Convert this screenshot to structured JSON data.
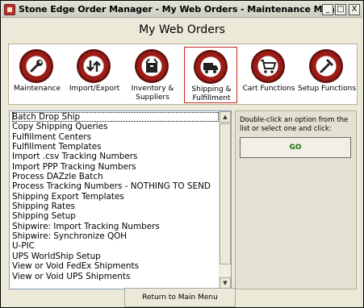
{
  "window": {
    "title": "Stone Edge Order Manager - My Web Orders - Maintenance Menu",
    "controls": {
      "minimize": "_",
      "maximize": "□",
      "close": "X"
    }
  },
  "header": {
    "title": "My Web Orders"
  },
  "toolbar": {
    "items": [
      {
        "label": "Maintenance",
        "icon": "wrench-icon"
      },
      {
        "label": "Import/Export",
        "icon": "import-export-icon"
      },
      {
        "label": "Inventory & Suppliers",
        "icon": "box-icon"
      },
      {
        "label": "Shipping & Fulfillment",
        "icon": "truck-icon",
        "active": true
      },
      {
        "label": "Cart Functions",
        "icon": "cart-icon"
      },
      {
        "label": "Setup Functions",
        "icon": "hammer-icon"
      }
    ]
  },
  "list": {
    "items": [
      "Batch Drop Ship",
      "Copy Shipping Queries",
      "Fulfillment Centers",
      "Fulfillment Templates",
      "Import .csv Tracking Numbers",
      "Import PPP Tracking Numbers",
      "Process DAZzle Batch",
      "Process Tracking Numbers - NOTHING TO SEND",
      "Shipping Export Templates",
      "Shipping Rates",
      "Shipping Setup",
      "Shipwire: Import Tracking Numbers",
      "Shipwire: Synchronize QOH",
      "U-PIC",
      "UPS WorldShip Setup",
      "View or Void FedEx Shipments",
      "View or Void UPS Shipments"
    ],
    "selected_index": 0
  },
  "side": {
    "help_text": "Double-click an option from the list or select one and click:",
    "go_label": "GO"
  },
  "footer": {
    "return_label": "Return to Main Menu"
  },
  "colors": {
    "accent_red": "#9b1b16",
    "go_green": "#1b6b10",
    "window_bg": "#ece9d8"
  }
}
